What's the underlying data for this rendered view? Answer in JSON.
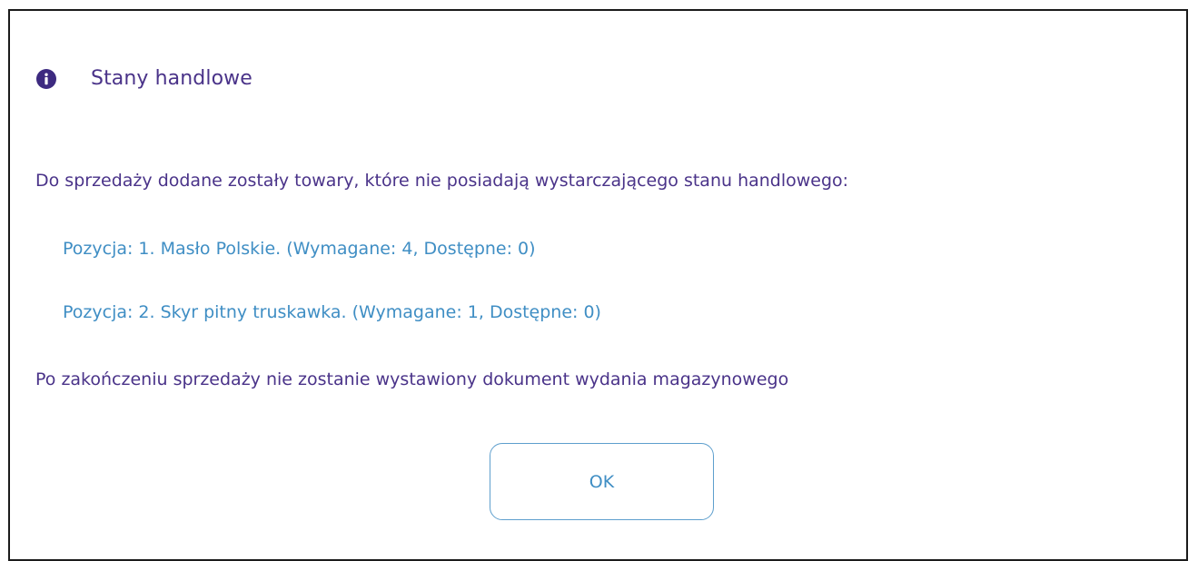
{
  "dialog": {
    "title": "Stany handlowe",
    "icon": "info-icon",
    "intro": "Do sprzedaży dodane zostały towary, które nie posiadają wystarczającego stanu handlowego:",
    "items": [
      {
        "text": "Pozycja: 1. Masło Polskie. (Wymagane: 4, Dostępne: 0)"
      },
      {
        "text": "Pozycja: 2. Skyr pitny truskawka. (Wymagane: 1, Dostępne: 0)"
      }
    ],
    "outro": "Po zakończeniu sprzedaży nie zostanie wystawiony dokument wydania magazynowego",
    "ok_label": "OK"
  },
  "colors": {
    "title": "#4a3389",
    "item": "#3f8ec4",
    "button_border": "#5e9fcd",
    "icon": "#3d2a80"
  }
}
